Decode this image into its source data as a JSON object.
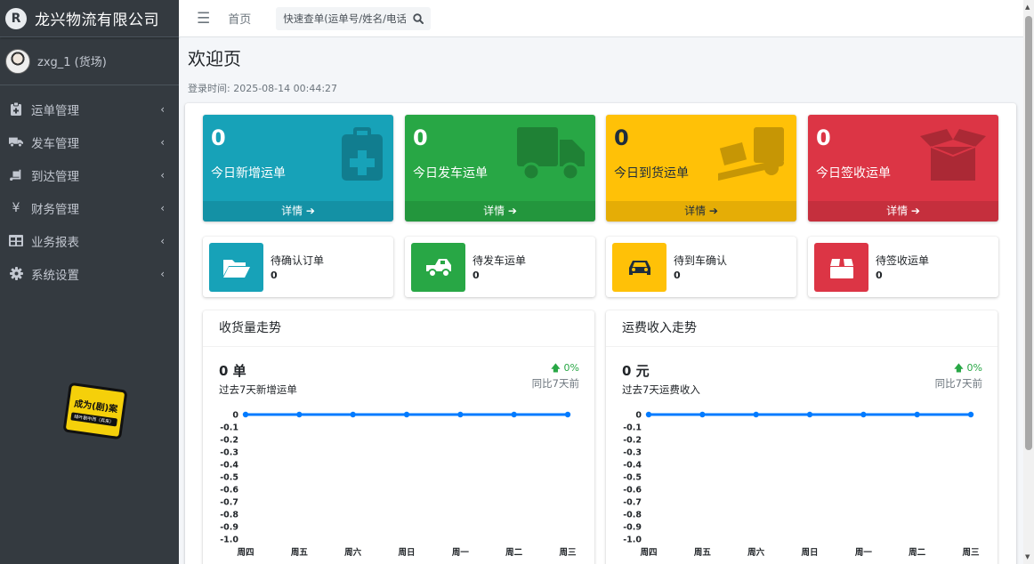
{
  "brand": {
    "logo": "R",
    "name": "龙兴物流有限公司"
  },
  "user": {
    "name": "zxg_1 (货场)"
  },
  "sidebar": {
    "items": [
      {
        "label": "运单管理",
        "icon": "clipboard-icon"
      },
      {
        "label": "发车管理",
        "icon": "truck-icon"
      },
      {
        "label": "到达管理",
        "icon": "dolly-icon"
      },
      {
        "label": "财务管理",
        "icon": "yen-icon"
      },
      {
        "label": "业务报表",
        "icon": "table-icon"
      },
      {
        "label": "系统设置",
        "icon": "gear-icon"
      }
    ]
  },
  "promo": {
    "title": "成为(剧)案",
    "subtitle": "绿叶剧中而（兵来）"
  },
  "topbar": {
    "home": "首页",
    "search_placeholder": "快速查单(运单号/姓名/电话)"
  },
  "header": {
    "title": "欢迎页",
    "login_time": "登录时间: 2025-08-14 00:44:27"
  },
  "small_boxes": [
    {
      "value": "0",
      "label": "今日新增运单",
      "footer": "详情 ➔",
      "color": "#17a2b8",
      "icon": "clipboard-plus-icon"
    },
    {
      "value": "0",
      "label": "今日发车运单",
      "footer": "详情 ➔",
      "color": "#28a745",
      "icon": "truck-icon"
    },
    {
      "value": "0",
      "label": "今日到货运单",
      "footer": "详情 ➔",
      "color": "#ffc107",
      "icon": "dolly-icon"
    },
    {
      "value": "0",
      "label": "今日签收运单",
      "footer": "详情 ➔",
      "color": "#dc3545",
      "icon": "box-open-icon"
    }
  ],
  "info_boxes": [
    {
      "label": "待确认订单",
      "value": "0",
      "color": "#17a2b8",
      "icon": "folder-open-icon"
    },
    {
      "label": "待发车运单",
      "value": "0",
      "color": "#28a745",
      "icon": "truck-pickup-icon"
    },
    {
      "label": "待到车确认",
      "value": "0",
      "color": "#ffc107",
      "icon": "car-icon"
    },
    {
      "label": "待签收运单",
      "value": "0",
      "color": "#dc3545",
      "icon": "box-icon"
    }
  ],
  "charts": [
    {
      "title": "收货量走势",
      "big": "0 单",
      "sub": "过去7天新增运单",
      "change": "0%",
      "compare": "同比7天前"
    },
    {
      "title": "运费收入走势",
      "big": "0 元",
      "sub": "过去7天运费收入",
      "change": "0%",
      "compare": "同比7天前"
    }
  ],
  "chart_data": [
    {
      "type": "line",
      "categories": [
        "周四",
        "周五",
        "周六",
        "周日",
        "周一",
        "周二",
        "周三"
      ],
      "values": [
        0,
        0,
        0,
        0,
        0,
        0,
        0
      ],
      "ylim": [
        -1.0,
        0
      ],
      "yticks": [
        "0",
        "-0.1",
        "-0.2",
        "-0.3",
        "-0.4",
        "-0.5",
        "-0.6",
        "-0.7",
        "-0.8",
        "-0.9",
        "-1.0"
      ],
      "color": "#007bff"
    },
    {
      "type": "line",
      "categories": [
        "周四",
        "周五",
        "周六",
        "周日",
        "周一",
        "周二",
        "周三"
      ],
      "values": [
        0,
        0,
        0,
        0,
        0,
        0,
        0
      ],
      "ylim": [
        -1.0,
        0
      ],
      "yticks": [
        "0",
        "-0.1",
        "-0.2",
        "-0.3",
        "-0.4",
        "-0.5",
        "-0.6",
        "-0.7",
        "-0.8",
        "-0.9",
        "-1.0"
      ],
      "color": "#007bff"
    }
  ]
}
